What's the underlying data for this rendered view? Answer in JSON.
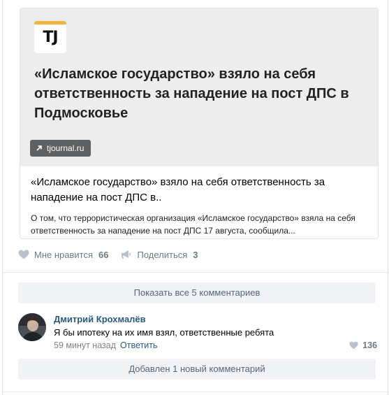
{
  "card": {
    "logo_text": "TJ",
    "cover_title": "«Исламское государство» взяло на себя ответственность за нападение на пост ДПС в Подмосковье",
    "domain": "tjournal.ru",
    "title": "«Исламское государство» взяло на себя ответственность за нападение на пост ДПС в..",
    "description": "О том, что террористическая организация «Исламское государство» взяла на себя ответственность за нападение на пост ДПС 17 августа, сообщила..."
  },
  "actions": {
    "like_label": "Мне нравится",
    "like_count": "66",
    "share_label": "Поделиться",
    "share_count": "3"
  },
  "comments": {
    "show_all_label": "Показать все 5 комментариев",
    "items": [
      {
        "author": "Дмитрий Крохмалёв",
        "text": "Я бы ипотеку на их имя взял, ответственные ребята",
        "time": "59 минут назад",
        "reply_label": "Ответить",
        "likes": "136"
      }
    ],
    "new_comment_label": "Добавлен 1 новый комментарий"
  },
  "colors": {
    "link": "#2a5885",
    "muted": "#828282",
    "action": "#6f7985",
    "button_bg": "#f0f2f5",
    "logo_accent": "#f3b33d"
  }
}
